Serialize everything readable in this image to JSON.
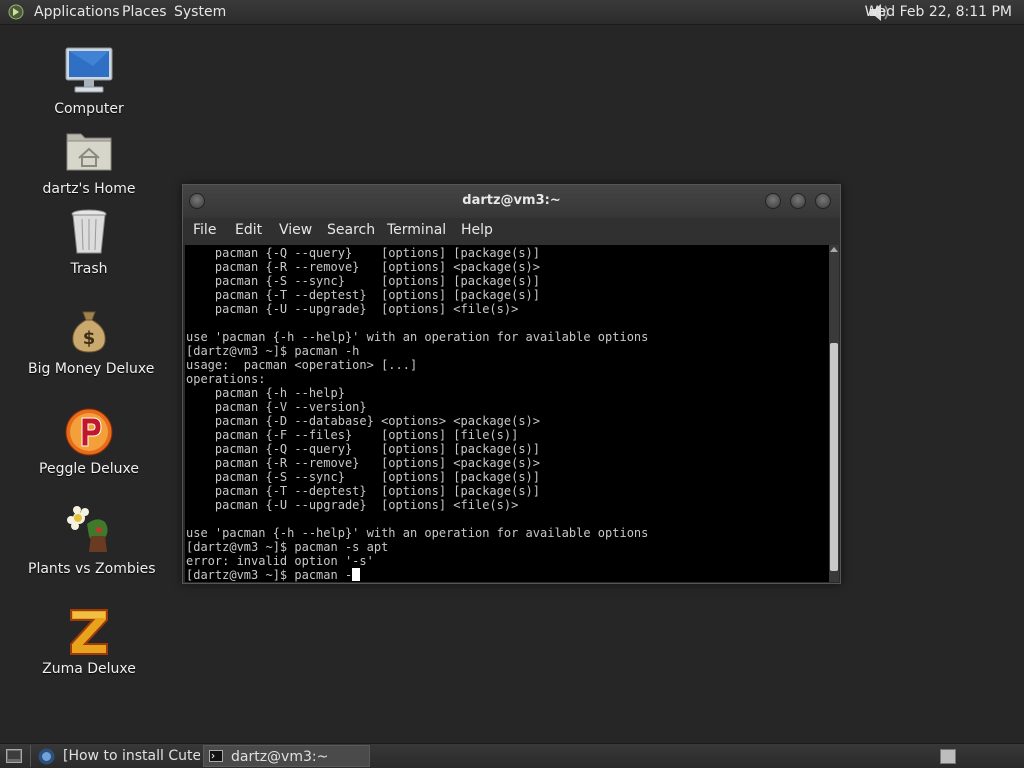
{
  "top_panel": {
    "menus": [
      "Applications",
      "Places",
      "System"
    ],
    "datetime": "Wed Feb 22,  8:11 PM"
  },
  "desktop_icons": [
    {
      "label": "Computer",
      "icon": "computer-icon"
    },
    {
      "label": "dartz's Home",
      "icon": "home-folder-icon"
    },
    {
      "label": "Trash",
      "icon": "trash-icon"
    },
    {
      "label": "Big Money Deluxe",
      "icon": "money-bag-icon"
    },
    {
      "label": "Peggle Deluxe",
      "icon": "peggle-icon"
    },
    {
      "label": "Plants vs Zombies",
      "icon": "plants-vs-zombies-icon"
    },
    {
      "label": "Zuma Deluxe",
      "icon": "zuma-icon"
    }
  ],
  "terminal": {
    "title": "dartz@vm3:~",
    "menu": [
      "File",
      "Edit",
      "View",
      "Search",
      "Terminal",
      "Help"
    ],
    "lines": [
      "    pacman {-Q --query}    [options] [package(s)]",
      "    pacman {-R --remove}   [options] <package(s)>",
      "    pacman {-S --sync}     [options] [package(s)]",
      "    pacman {-T --deptest}  [options] [package(s)]",
      "    pacman {-U --upgrade}  [options] <file(s)>",
      "",
      "use 'pacman {-h --help}' with an operation for available options",
      "[dartz@vm3 ~]$ pacman -h",
      "usage:  pacman <operation> [...]",
      "operations:",
      "    pacman {-h --help}",
      "    pacman {-V --version}",
      "    pacman {-D --database} <options> <package(s)>",
      "    pacman {-F --files}    [options] [file(s)]",
      "    pacman {-Q --query}    [options] [package(s)]",
      "    pacman {-R --remove}   [options] <package(s)>",
      "    pacman {-S --sync}     [options] [package(s)]",
      "    pacman {-T --deptest}  [options] [package(s)]",
      "    pacman {-U --upgrade}  [options] <file(s)>",
      "",
      "use 'pacman {-h --help}' with an operation for available options",
      "[dartz@vm3 ~]$ pacman -s apt",
      "error: invalid option '-s'"
    ],
    "prompt_line": "[dartz@vm3 ~]$ pacman -"
  },
  "taskbar": {
    "tasks": [
      {
        "label": "[How to install Cute...",
        "icon": "browser-icon"
      },
      {
        "label": "dartz@vm3:~",
        "icon": "terminal-icon"
      }
    ]
  }
}
